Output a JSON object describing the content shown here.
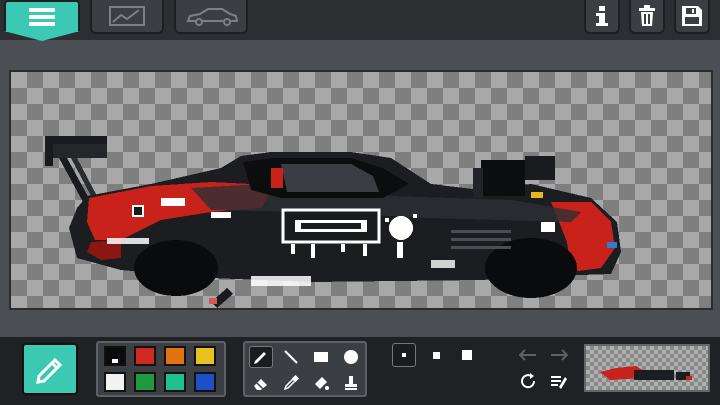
{
  "colors": {
    "accent": "#3cc9b4",
    "topbar": "#2c2e32",
    "background": "#4b4e53",
    "toolbar": "#1f2124"
  },
  "header": {
    "menu_icon": "hamburger-icon",
    "tabs": [
      {
        "icon": "image-canvas-icon"
      },
      {
        "icon": "car-silhouette-icon"
      }
    ],
    "actions": [
      {
        "icon": "info-icon"
      },
      {
        "icon": "trash-icon"
      },
      {
        "icon": "save-floppy-icon"
      }
    ]
  },
  "canvas": {
    "background": "transparency-checkerboard",
    "drawing": "pixel-art-drift-car"
  },
  "palette": {
    "swatches": [
      "#0b0b0b",
      "#d1291f",
      "#e0730f",
      "#e9c11d",
      "#f2f2f2",
      "#1f9a3c",
      "#1fc28e",
      "#1e4fc8"
    ],
    "selected_index": 0
  },
  "tools": {
    "items": [
      "pencil-icon",
      "line-icon",
      "rectangle-icon",
      "circle-icon",
      "eraser-icon",
      "eyedropper-icon",
      "bucket-fill-icon",
      "stamp-icon"
    ],
    "selected": "pencil-icon"
  },
  "brush_sizes": {
    "items": [
      "small",
      "medium",
      "large"
    ],
    "selected": "small"
  },
  "history": {
    "undo_icon": "undo-arrow-icon",
    "redo_icon": "redo-arrow-icon",
    "rotate_icon": "rotate-icon",
    "clear_icon": "clear-layer-icon"
  },
  "preview": {
    "icon": "thumbnail-preview"
  }
}
